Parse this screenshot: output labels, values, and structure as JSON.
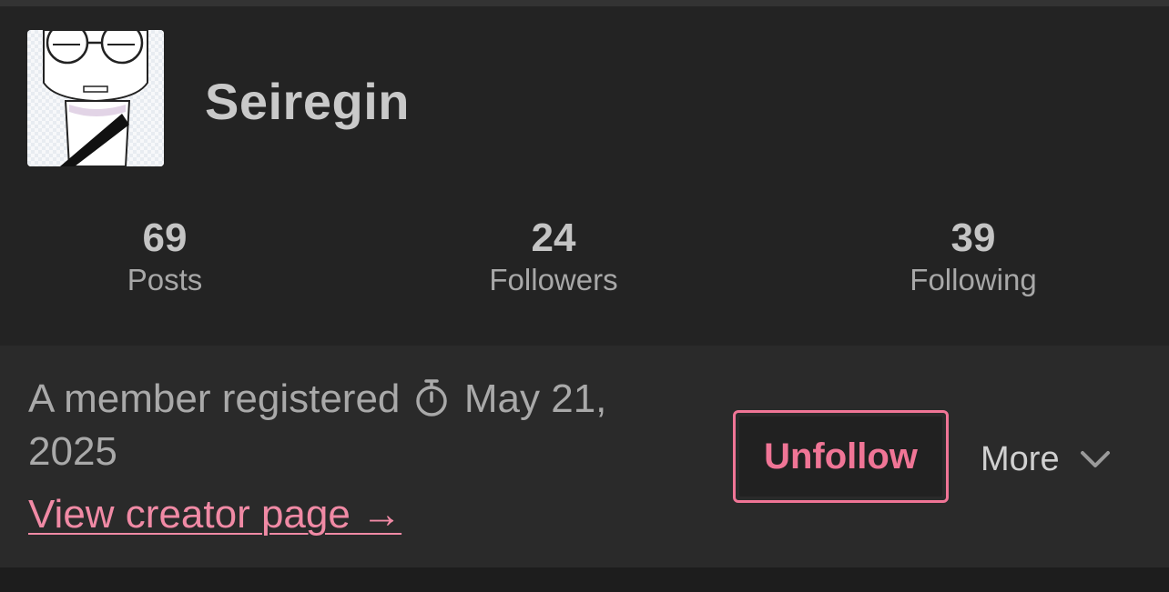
{
  "profile": {
    "username": "Seiregin",
    "avatar_alt": "avatar"
  },
  "stats": [
    {
      "value": "69",
      "label": "Posts"
    },
    {
      "value": "24",
      "label": "Followers"
    },
    {
      "value": "39",
      "label": "Following"
    }
  ],
  "info": {
    "member_prefix": "A member registered",
    "registered_date": "May 21, 2025",
    "clock_icon": "stopwatch-icon",
    "creator_link": "View creator page →"
  },
  "actions": {
    "unfollow_label": "Unfollow",
    "more_label": "More",
    "more_icon": "chevron-down-icon"
  },
  "colors": {
    "accent": "#f07596",
    "link": "#f08aa5",
    "background": "#232323",
    "info_background": "#2a2a2a"
  }
}
